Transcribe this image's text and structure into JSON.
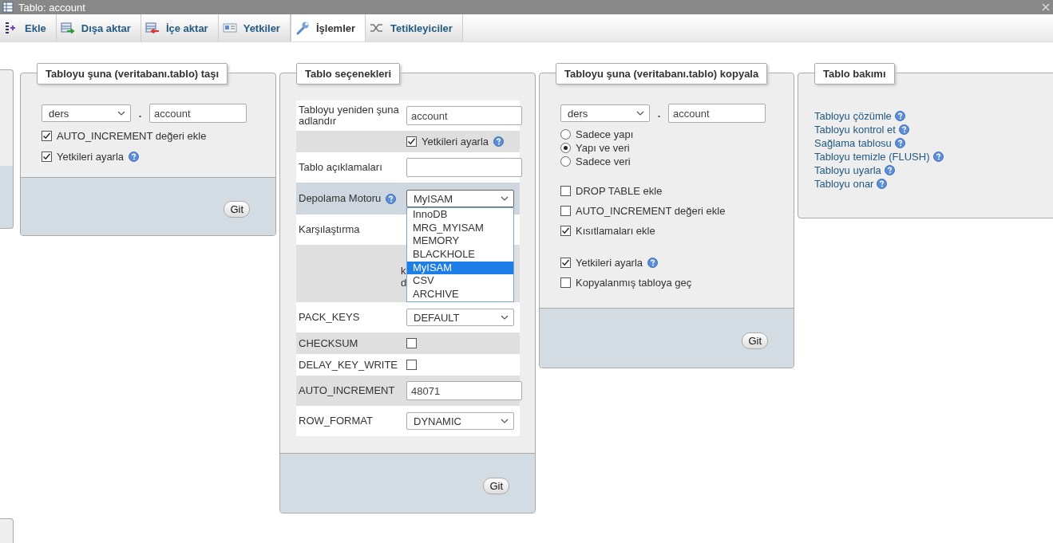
{
  "window": {
    "title": "Tablo: account"
  },
  "tabs": [
    {
      "kind": "insert",
      "label": "Ekle",
      "selected": false
    },
    {
      "kind": "export",
      "label": "Dışa aktar",
      "selected": false
    },
    {
      "kind": "import",
      "label": "İçe aktar",
      "selected": false
    },
    {
      "kind": "privileges",
      "label": "Yetkiler",
      "selected": false
    },
    {
      "kind": "operations",
      "label": "İşlemler",
      "selected": true
    },
    {
      "kind": "triggers",
      "label": "Tetikleyiciler",
      "selected": false
    }
  ],
  "move_panel": {
    "legend": "Tabloyu şuna (veritabanı.tablo) taşı",
    "database": "ders",
    "separator": ".",
    "table": "account",
    "options": [
      {
        "label": "AUTO_INCREMENT değeri ekle",
        "checked": true,
        "help": false
      },
      {
        "label": "Yetkileri ayarla",
        "checked": true,
        "help": true
      }
    ],
    "button": "Git"
  },
  "options_panel": {
    "legend": "Tablo seçenekleri",
    "rows": [
      {
        "kind": "text",
        "label": "Tabloyu yeniden şuna adlandır",
        "value": "account"
      },
      {
        "kind": "check",
        "checked": true,
        "option_label": "Yetkileri ayarla",
        "help": true
      },
      {
        "kind": "text",
        "label": "Tablo açıklamaları",
        "value": ""
      },
      {
        "kind": "select",
        "label": "Depolama Motoru",
        "value": "MyISAM",
        "help": true,
        "highlighted": true,
        "open": true
      },
      {
        "kind": "label",
        "label": "Karşılaştırma"
      },
      {
        "kind": "fragments",
        "texts": [
          "k",
          "d"
        ]
      },
      {
        "kind": "select",
        "label": "PACK_KEYS",
        "value": "DEFAULT",
        "help": false,
        "highlighted": false,
        "open": false
      },
      {
        "kind": "checkbox",
        "label": "CHECKSUM",
        "checked": false
      },
      {
        "kind": "checkbox",
        "label": "DELAY_KEY_WRITE",
        "checked": false
      },
      {
        "kind": "text",
        "label": "AUTO_INCREMENT",
        "value": "48071"
      },
      {
        "kind": "select",
        "label": "ROW_FORMAT",
        "value": "DYNAMIC",
        "help": false,
        "highlighted": false,
        "open": false
      }
    ],
    "engine_options": [
      {
        "label": "InnoDB",
        "selected": false
      },
      {
        "label": "MRG_MYISAM",
        "selected": false
      },
      {
        "label": "MEMORY",
        "selected": false
      },
      {
        "label": "BLACKHOLE",
        "selected": false
      },
      {
        "label": "MyISAM",
        "selected": true
      },
      {
        "label": "CSV",
        "selected": false
      },
      {
        "label": "ARCHIVE",
        "selected": false
      }
    ],
    "button": "Git"
  },
  "copy_panel": {
    "legend": "Tabloyu şuna (veritabanı.tablo) kopyala",
    "database": "ders",
    "separator": ".",
    "table": "account",
    "modes": [
      {
        "label": "Sadece yapı",
        "selected": false
      },
      {
        "label": "Yapı ve veri",
        "selected": true
      },
      {
        "label": "Sadece veri",
        "selected": false
      }
    ],
    "options": [
      {
        "label": "DROP TABLE ekle",
        "checked": false,
        "help": false
      },
      {
        "label": "AUTO_INCREMENT değeri ekle",
        "checked": false,
        "help": false
      },
      {
        "label": "Kısıtlamaları ekle",
        "checked": true,
        "help": false
      }
    ],
    "more_options": [
      {
        "label": "Yetkileri ayarla",
        "checked": true,
        "help": true
      },
      {
        "label": "Kopyalanmış tabloya geç",
        "checked": false,
        "help": false
      }
    ],
    "button": "Git"
  },
  "maintenance_panel": {
    "legend": "Tablo bakımı",
    "links": [
      {
        "label": "Tabloyu çözümle",
        "help": true
      },
      {
        "label": "Tabloyu kontrol et",
        "help": true
      },
      {
        "label": "Sağlama tablosu",
        "help": true
      },
      {
        "label": "Tabloyu temizle (FLUSH)",
        "help": true
      },
      {
        "label": "Tabloyu uyarla",
        "help": true
      },
      {
        "label": "Tabloyu onar",
        "help": true
      }
    ]
  }
}
